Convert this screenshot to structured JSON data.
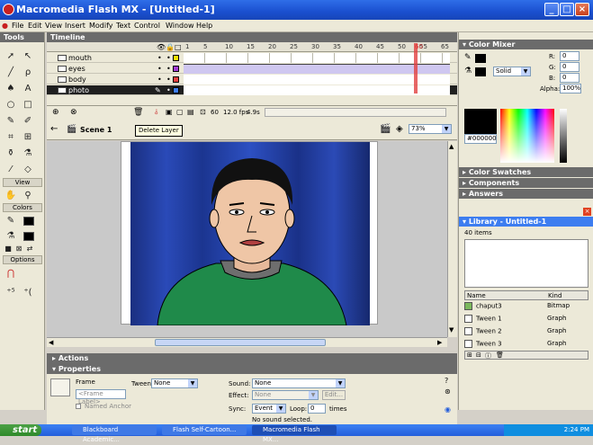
{
  "window": {
    "title": "Macromedia Flash MX - [Untitled-1]",
    "minimize": "_",
    "maximize": "□",
    "close": "×"
  },
  "menu": [
    "File",
    "Edit",
    "View",
    "Insert",
    "Modify",
    "Text",
    "Control",
    "Window",
    "Help"
  ],
  "tools": {
    "header": "Tools",
    "view_label": "View",
    "colors_label": "Colors",
    "options_label": "Options"
  },
  "timeline": {
    "header": "Timeline",
    "ticks": [
      "1",
      "5",
      "10",
      "15",
      "20",
      "25",
      "30",
      "35",
      "40",
      "45",
      "50",
      "55",
      "60",
      "65"
    ],
    "layers": [
      {
        "name": "mouth",
        "color": "#f4e200"
      },
      {
        "name": "eyes",
        "color": "#a23cd6"
      },
      {
        "name": "body",
        "color": "#e14040"
      },
      {
        "name": "photo",
        "color": "#3d7df0",
        "selected": true
      }
    ],
    "current_frame": "60",
    "fps": "12.0 fps",
    "time": "4.9s"
  },
  "scene": {
    "label": "Scene 1",
    "zoom": "73%"
  },
  "tooltip": "Delete Layer",
  "actions_label": "Actions",
  "properties": {
    "header": "Properties",
    "frame_label": "Frame",
    "frame_placeholder": "<Frame Label>",
    "named_anchor": "Named Anchor",
    "tween_label": "Tween:",
    "tween_value": "None",
    "sound_label": "Sound:",
    "sound_value": "None",
    "effect_label": "Effect:",
    "effect_value": "None",
    "edit_label": "Edit...",
    "sync_label": "Sync:",
    "sync_value": "Event",
    "loop_label": "Loop:",
    "loop_value": "0",
    "times_label": "times",
    "status": "No sound selected."
  },
  "color_mixer": {
    "header": "Color Mixer",
    "fill_type": "Solid",
    "r_label": "R:",
    "r": "0",
    "g_label": "G:",
    "g": "0",
    "b_label": "B:",
    "b": "0",
    "alpha_label": "Alpha:",
    "alpha": "100%",
    "hex": "#000000"
  },
  "panels": [
    "Color Swatches",
    "Components",
    "Answers"
  ],
  "library": {
    "header": "Library - Untitled-1",
    "count": "40 items",
    "col_name": "Name",
    "col_kind": "Kind",
    "items": [
      {
        "name": "chaput3",
        "kind": "Bitmap"
      },
      {
        "name": "Tween 1",
        "kind": "Graph"
      },
      {
        "name": "Tween 2",
        "kind": "Graph"
      },
      {
        "name": "Tween 3",
        "kind": "Graph"
      }
    ]
  },
  "taskbar": {
    "start": "start",
    "tasks": [
      "Blackboard Academic...",
      "Flash Self-Cartoon...",
      "Macromedia Flash MX..."
    ],
    "clock": "2:24 PM"
  },
  "colors": {
    "accent": "#3d7df0",
    "panel_header": "#6b6b6b",
    "stage_bg": "#1f3f9e"
  }
}
